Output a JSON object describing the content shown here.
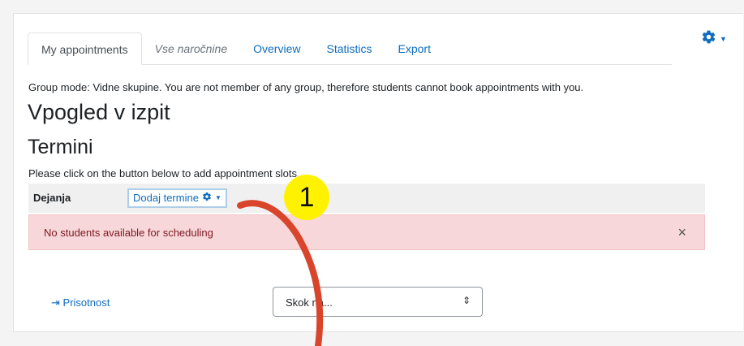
{
  "tabs": [
    {
      "label": "My appointments"
    },
    {
      "label": "Vse naročnine"
    },
    {
      "label": "Overview"
    },
    {
      "label": "Statistics"
    },
    {
      "label": "Export"
    }
  ],
  "notice": "Group mode: Vidne skupine. You are not member of any group, therefore students cannot book appointments with you.",
  "title": "Vpogled v izpit",
  "subtitle": "Termini",
  "instruction": "Please click on the button below to add appointment slots.",
  "actions": {
    "label": "Dejanja",
    "add_button": "Dodaj termine"
  },
  "alert": {
    "text": "No students available for scheduling",
    "close": "×"
  },
  "footer": {
    "back_link": "Prisotnost",
    "jump_placeholder": "Skok na..."
  },
  "annotation": {
    "badge": "1"
  },
  "icons": {
    "settings": "gear-icon",
    "arrow": "arrow-right-icon",
    "select": "sort-arrows-icon"
  },
  "colors": {
    "link": "#0f6cbf",
    "alert_bg": "#f7d7da",
    "alert_text": "#7d1a21",
    "badge": "#fff200",
    "annotation_stroke": "#d9452b"
  }
}
